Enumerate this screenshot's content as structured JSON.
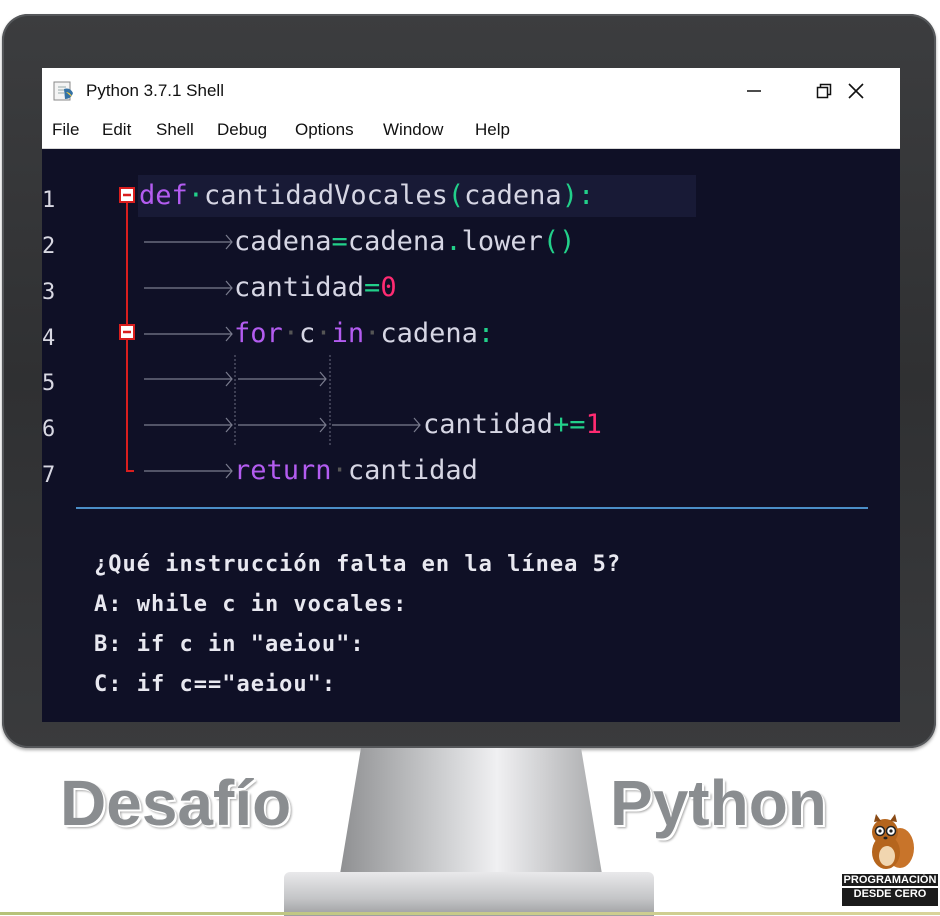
{
  "window": {
    "title": "Python 3.7.1 Shell"
  },
  "menu": [
    "File",
    "Edit",
    "Shell",
    "Debug",
    "Options",
    "Window",
    "Help"
  ],
  "code": {
    "line_numbers": [
      "1",
      "2",
      "3",
      "4",
      "5",
      "6",
      "7"
    ],
    "line1": {
      "kw": "def",
      "name": "cantidadVocales",
      "open": "(",
      "param": "cadena",
      "close": "):"
    },
    "line2": {
      "lhs": "cadena",
      "eq": "=",
      "rhs": "cadena",
      "dot": ".",
      "method": "lower",
      "parens": "()"
    },
    "line3": {
      "lhs": "cantidad",
      "eq": "=",
      "num": "0"
    },
    "line4": {
      "kw1": "for",
      "var": "c",
      "kw2": "in",
      "iter": "cadena",
      "colon": ":"
    },
    "line6": {
      "lhs": "cantidad",
      "op": "+=",
      "num": "1"
    },
    "line7": {
      "kw": "return",
      "val": "cantidad"
    }
  },
  "question": {
    "prompt": "¿Qué instrucción falta en la línea 5?",
    "option_a": "A: while c in vocales:",
    "option_b": "B: if c in \"aeiou\":",
    "option_c": "C: if c==\"aeiou\":"
  },
  "banner": {
    "left": "Desafío",
    "right": "Python"
  },
  "logo": {
    "line1": "PROGRAMACIÓN",
    "line2": "DESDE CERO"
  },
  "colors": {
    "editor_bg": "#0f1026",
    "keyword": "#b35cf0",
    "operator": "#22d08a",
    "number": "#ff2b72",
    "identifier": "#d6d6e4",
    "fold_marker": "#d91e1e"
  }
}
